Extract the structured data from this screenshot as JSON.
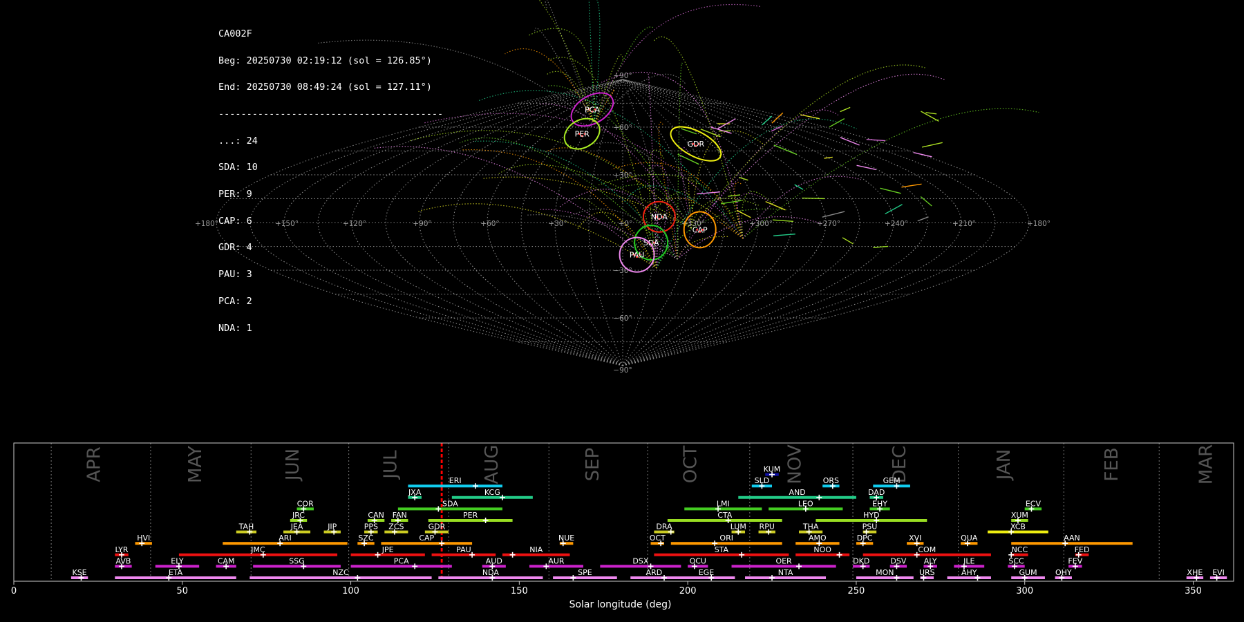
{
  "info": {
    "camera": "CA002F",
    "begin": "Beg: 20250730 02:19:12 (sol = 126.85°)",
    "end": "End: 20250730 08:49:24 (sol = 127.11°)",
    "separator": "----------------------------------------",
    "counts": [
      {
        "label": "...: 24"
      },
      {
        "label": "SDA: 10"
      },
      {
        "label": "PER: 9"
      },
      {
        "label": "CAP: 6"
      },
      {
        "label": "GDR: 4"
      },
      {
        "label": "PAU: 3"
      },
      {
        "label": "PCA: 2"
      },
      {
        "label": "NDA: 1"
      }
    ]
  },
  "colors": {
    "background": "#000000",
    "grid": "#9a9a9a",
    "axis": "#cccccc",
    "solar_marker": "#ff0000",
    "month_label": "#555555"
  },
  "chart_data": [
    {
      "type": "scatter",
      "projection": "sinusoidal",
      "grid": true,
      "lon_ticks": [
        "+180°",
        "+150°",
        "+120°",
        "+90°",
        "+60°",
        "+30°",
        "+0°",
        "+330°",
        "+300°",
        "+270°",
        "+240°",
        "+210°",
        "+180°"
      ],
      "lat_ticks": [
        "+90°",
        "+60°",
        "+30°",
        "+0°",
        "−30°",
        "−60°",
        "−90°"
      ],
      "radiants": [
        {
          "name": "PCA",
          "color": "#cc22cc",
          "pos": [
            -0.075,
            0.79
          ],
          "rx": 20,
          "ry": 33,
          "rot": 60
        },
        {
          "name": "PER",
          "color": "#aaee22",
          "pos": [
            -0.1,
            0.62
          ],
          "rx": 20,
          "ry": 27,
          "rot": 60
        },
        {
          "name": "GDR",
          "color": "#eeee11",
          "pos": [
            0.18,
            0.55
          ],
          "rx": 18,
          "ry": 40,
          "rot": -62
        },
        {
          "name": "NDA",
          "color": "#ee2211",
          "pos": [
            0.09,
            0.04
          ],
          "rx": 23,
          "ry": 22,
          "rot": 0
        },
        {
          "name": "CAP",
          "color": "#ff9900",
          "pos": [
            0.19,
            -0.05
          ],
          "rx": 23,
          "ry": 26,
          "rot": 0
        },
        {
          "name": "SDA",
          "color": "#22cc22",
          "pos": [
            0.07,
            -0.14
          ],
          "rx": 24,
          "ry": 25,
          "rot": 0
        },
        {
          "name": "PAU",
          "color": "#ee88ee",
          "pos": [
            0.035,
            -0.225
          ],
          "rx": 25,
          "ry": 25,
          "rot": 0
        }
      ]
    },
    {
      "type": "bar",
      "xlabel": "Solar longitude (deg)",
      "xlim": [
        0,
        362
      ],
      "x_ticks": [
        0,
        50,
        100,
        150,
        200,
        250,
        300,
        350
      ],
      "current_sol": [
        126.85,
        127.11
      ],
      "months": [
        {
          "label": "APR",
          "start": 11.1,
          "center": 24
        },
        {
          "label": "MAY",
          "start": 40.6,
          "center": 54
        },
        {
          "label": "JUN",
          "start": 70.4,
          "center": 83
        },
        {
          "label": "JUL",
          "start": 99.4,
          "center": 112
        },
        {
          "label": "AUG",
          "start": 129.1,
          "center": 142
        },
        {
          "label": "SEP",
          "start": 158.8,
          "center": 172
        },
        {
          "label": "OCT",
          "start": 188.1,
          "center": 201
        },
        {
          "label": "NOV",
          "start": 218.4,
          "center": 232
        },
        {
          "label": "DEC",
          "start": 249.0,
          "center": 263
        },
        {
          "label": "JAN",
          "start": 280.3,
          "center": 294
        },
        {
          "label": "FEB",
          "start": 311.6,
          "center": 326
        },
        {
          "label": "MAR",
          "start": 339.9,
          "center": 354
        }
      ],
      "showers": [
        {
          "code": "KUM",
          "start": 223,
          "end": 227,
          "peak": 225,
          "row": 10,
          "color": "#1111aa"
        },
        {
          "code": "ERI",
          "start": 117,
          "end": 145,
          "peak": 137,
          "row": 9,
          "color": "#11ccee"
        },
        {
          "code": "SLD",
          "start": 219,
          "end": 225,
          "peak": 222,
          "row": 9,
          "color": "#11ccee"
        },
        {
          "code": "ORS",
          "start": 240,
          "end": 245,
          "peak": 243,
          "row": 9,
          "color": "#11ccee"
        },
        {
          "code": "GEM",
          "start": 255,
          "end": 266,
          "peak": 262,
          "row": 9,
          "color": "#11ccee"
        },
        {
          "code": "JXA",
          "start": 117,
          "end": 121,
          "peak": 119,
          "row": 8,
          "color": "#22cc88"
        },
        {
          "code": "KCG",
          "start": 130,
          "end": 154,
          "peak": 145,
          "row": 8,
          "color": "#22cc88"
        },
        {
          "code": "AND",
          "start": 215,
          "end": 250,
          "peak": 239,
          "row": 8,
          "color": "#22cc88"
        },
        {
          "code": "DAD",
          "start": 254,
          "end": 258,
          "peak": 256,
          "row": 8,
          "color": "#22cc88"
        },
        {
          "code": "COR",
          "start": 84,
          "end": 89,
          "peak": 86,
          "row": 7,
          "color": "#44cc22"
        },
        {
          "code": "SDA",
          "start": 114,
          "end": 145,
          "peak": 126,
          "row": 7,
          "color": "#44cc22"
        },
        {
          "code": "LMI",
          "start": 199,
          "end": 222,
          "peak": 209,
          "row": 7,
          "color": "#44cc22"
        },
        {
          "code": "LEO",
          "start": 224,
          "end": 246,
          "peak": 235,
          "row": 7,
          "color": "#44cc22"
        },
        {
          "code": "EHY",
          "start": 254,
          "end": 260,
          "peak": 257,
          "row": 7,
          "color": "#44cc22"
        },
        {
          "code": "ECV",
          "start": 300,
          "end": 305,
          "peak": 302,
          "row": 7,
          "color": "#44cc22"
        },
        {
          "code": "JRC",
          "start": 82,
          "end": 87,
          "peak": 85,
          "row": 6,
          "color": "#99dd22"
        },
        {
          "code": "CAN",
          "start": 105,
          "end": 110,
          "peak": 107,
          "row": 6,
          "color": "#99dd22"
        },
        {
          "code": "FAN",
          "start": 112,
          "end": 117,
          "peak": 114,
          "row": 6,
          "color": "#99dd22"
        },
        {
          "code": "PER",
          "start": 123,
          "end": 148,
          "peak": 140,
          "row": 6,
          "color": "#99dd22"
        },
        {
          "code": "CTA",
          "start": 194,
          "end": 228,
          "peak": 212,
          "row": 6,
          "color": "#99dd22"
        },
        {
          "code": "HYD",
          "start": 238,
          "end": 271,
          "peak": 256,
          "row": 6,
          "color": "#99dd22"
        },
        {
          "code": "XUM",
          "start": 296,
          "end": 301,
          "peak": 298,
          "row": 6,
          "color": "#99dd22"
        },
        {
          "code": "TAH",
          "start": 66,
          "end": 72,
          "peak": 70,
          "row": 5,
          "color": "#cccc22"
        },
        {
          "code": "JEA",
          "start": 80,
          "end": 88,
          "peak": 84,
          "row": 5,
          "color": "#cccc22"
        },
        {
          "code": "JIP",
          "start": 92,
          "end": 97,
          "peak": 95,
          "row": 5,
          "color": "#cccc22"
        },
        {
          "code": "PPS",
          "start": 104,
          "end": 108,
          "peak": 106,
          "row": 5,
          "color": "#cccc22"
        },
        {
          "code": "ZCS",
          "start": 110,
          "end": 117,
          "peak": 113,
          "row": 5,
          "color": "#cccc22"
        },
        {
          "code": "GDR",
          "start": 122,
          "end": 129,
          "peak": 125,
          "row": 5,
          "color": "#cccc22"
        },
        {
          "code": "DRA",
          "start": 190,
          "end": 196,
          "peak": 195,
          "row": 5,
          "color": "#cccc22"
        },
        {
          "code": "LUM",
          "start": 213,
          "end": 217,
          "peak": 215,
          "row": 5,
          "color": "#cccc22"
        },
        {
          "code": "RPU",
          "start": 221,
          "end": 226,
          "peak": 224,
          "row": 5,
          "color": "#cccc22"
        },
        {
          "code": "THA",
          "start": 233,
          "end": 240,
          "peak": 236,
          "row": 5,
          "color": "#cccc22"
        },
        {
          "code": "PSU",
          "start": 252,
          "end": 256,
          "peak": 253,
          "row": 5,
          "color": "#cccc22"
        },
        {
          "code": "XCB",
          "start": 289,
          "end": 307,
          "peak": 296,
          "row": 5,
          "color": "#eeee11"
        },
        {
          "code": "HVI",
          "start": 36,
          "end": 41,
          "peak": 38,
          "row": 4,
          "color": "#ff9900"
        },
        {
          "code": "ARI",
          "start": 62,
          "end": 99,
          "peak": 79,
          "row": 4,
          "color": "#ff9900"
        },
        {
          "code": "SZC",
          "start": 102,
          "end": 107,
          "peak": 104,
          "row": 4,
          "color": "#ff9900"
        },
        {
          "code": "CAP",
          "start": 109,
          "end": 136,
          "peak": 127,
          "row": 4,
          "color": "#ff9900"
        },
        {
          "code": "NUE",
          "start": 162,
          "end": 166,
          "peak": 163,
          "row": 4,
          "color": "#ff9900"
        },
        {
          "code": "OCT",
          "start": 189,
          "end": 193,
          "peak": 192,
          "row": 4,
          "color": "#ff9900"
        },
        {
          "code": "ORI",
          "start": 195,
          "end": 228,
          "peak": 208,
          "row": 4,
          "color": "#ff9900"
        },
        {
          "code": "AMO",
          "start": 232,
          "end": 245,
          "peak": 239,
          "row": 4,
          "color": "#ff9900"
        },
        {
          "code": "DPC",
          "start": 250,
          "end": 255,
          "peak": 252,
          "row": 4,
          "color": "#ff9900"
        },
        {
          "code": "XVI",
          "start": 265,
          "end": 270,
          "peak": 268,
          "row": 4,
          "color": "#ff9900"
        },
        {
          "code": "QUA",
          "start": 281,
          "end": 286,
          "peak": 283,
          "row": 4,
          "color": "#ff9900"
        },
        {
          "code": "AAN",
          "start": 296,
          "end": 332,
          "peak": 312,
          "row": 4,
          "color": "#ff9900"
        },
        {
          "code": "LYR",
          "start": 30,
          "end": 34,
          "peak": 32,
          "row": 3,
          "color": "#ee1111"
        },
        {
          "code": "JMC",
          "start": 49,
          "end": 96,
          "peak": 74,
          "row": 3,
          "color": "#ee1111"
        },
        {
          "code": "JPE",
          "start": 100,
          "end": 122,
          "peak": 108,
          "row": 3,
          "color": "#ee1111"
        },
        {
          "code": "PAU",
          "start": 124,
          "end": 143,
          "peak": 136,
          "row": 3,
          "color": "#ee1111"
        },
        {
          "code": "NIA",
          "start": 145,
          "end": 165,
          "peak": 148,
          "row": 3,
          "color": "#ee1111"
        },
        {
          "code": "STA",
          "start": 190,
          "end": 230,
          "peak": 216,
          "row": 3,
          "color": "#ee1111"
        },
        {
          "code": "NOO",
          "start": 232,
          "end": 248,
          "peak": 245,
          "row": 3,
          "color": "#ee1111"
        },
        {
          "code": "COM",
          "start": 252,
          "end": 290,
          "peak": 268,
          "row": 3,
          "color": "#ee1111"
        },
        {
          "code": "NCC",
          "start": 296,
          "end": 301,
          "peak": 296,
          "row": 3,
          "color": "#ee1111"
        },
        {
          "code": "FED",
          "start": 315,
          "end": 319,
          "peak": 316,
          "row": 3,
          "color": "#ee1111"
        },
        {
          "code": "AVB",
          "start": 30,
          "end": 35,
          "peak": 32,
          "row": 2,
          "color": "#cc22cc"
        },
        {
          "code": "ELY",
          "start": 42,
          "end": 55,
          "peak": 49,
          "row": 2,
          "color": "#cc22cc"
        },
        {
          "code": "CAM",
          "start": 60,
          "end": 66,
          "peak": 63,
          "row": 2,
          "color": "#cc22cc"
        },
        {
          "code": "SSG",
          "start": 71,
          "end": 97,
          "peak": 86,
          "row": 2,
          "color": "#cc22cc"
        },
        {
          "code": "PCA",
          "start": 100,
          "end": 130,
          "peak": 119,
          "row": 2,
          "color": "#cc22cc"
        },
        {
          "code": "AUD",
          "start": 139,
          "end": 146,
          "peak": 142,
          "row": 2,
          "color": "#cc22cc"
        },
        {
          "code": "AUR",
          "start": 153,
          "end": 169,
          "peak": 158,
          "row": 2,
          "color": "#cc22cc"
        },
        {
          "code": "DSX",
          "start": 174,
          "end": 198,
          "peak": 189,
          "row": 2,
          "color": "#cc22cc"
        },
        {
          "code": "OCU",
          "start": 200,
          "end": 206,
          "peak": 202,
          "row": 2,
          "color": "#cc22cc"
        },
        {
          "code": "OER",
          "start": 213,
          "end": 244,
          "peak": 233,
          "row": 2,
          "color": "#cc22cc"
        },
        {
          "code": "DKD",
          "start": 249,
          "end": 254,
          "peak": 252,
          "row": 2,
          "color": "#cc22cc"
        },
        {
          "code": "DSV",
          "start": 260,
          "end": 265,
          "peak": 262,
          "row": 2,
          "color": "#cc22cc"
        },
        {
          "code": "ALY",
          "start": 270,
          "end": 274,
          "peak": 272,
          "row": 2,
          "color": "#cc22cc"
        },
        {
          "code": "ILE",
          "start": 279,
          "end": 288,
          "peak": 282,
          "row": 2,
          "color": "#cc22cc"
        },
        {
          "code": "SCC",
          "start": 295,
          "end": 300,
          "peak": 297,
          "row": 2,
          "color": "#cc22cc"
        },
        {
          "code": "FEV",
          "start": 313,
          "end": 317,
          "peak": 315,
          "row": 2,
          "color": "#cc22cc"
        },
        {
          "code": "KSE",
          "start": 17,
          "end": 22,
          "peak": 20,
          "row": 1,
          "color": "#ee88ee"
        },
        {
          "code": "ETA",
          "start": 30,
          "end": 66,
          "peak": 46,
          "row": 1,
          "color": "#ee88ee"
        },
        {
          "code": "NZC",
          "start": 70,
          "end": 124,
          "peak": 102,
          "row": 1,
          "color": "#ee88ee"
        },
        {
          "code": "NDA",
          "start": 126,
          "end": 157,
          "peak": 142,
          "row": 1,
          "color": "#ee88ee"
        },
        {
          "code": "SPE",
          "start": 160,
          "end": 179,
          "peak": 166,
          "row": 1,
          "color": "#ee88ee"
        },
        {
          "code": "ARD",
          "start": 183,
          "end": 197,
          "peak": 193,
          "row": 1,
          "color": "#ee88ee"
        },
        {
          "code": "EGE",
          "start": 197,
          "end": 214,
          "peak": 207,
          "row": 1,
          "color": "#ee88ee"
        },
        {
          "code": "NTA",
          "start": 217,
          "end": 241,
          "peak": 225,
          "row": 1,
          "color": "#ee88ee"
        },
        {
          "code": "MON",
          "start": 250,
          "end": 267,
          "peak": 262,
          "row": 1,
          "color": "#ee88ee"
        },
        {
          "code": "URS",
          "start": 269,
          "end": 273,
          "peak": 270,
          "row": 1,
          "color": "#ee88ee"
        },
        {
          "code": "AHY",
          "start": 277,
          "end": 290,
          "peak": 286,
          "row": 1,
          "color": "#ee88ee"
        },
        {
          "code": "GUM",
          "start": 296,
          "end": 306,
          "peak": 300,
          "row": 1,
          "color": "#ee88ee"
        },
        {
          "code": "OHY",
          "start": 309,
          "end": 314,
          "peak": 311,
          "row": 1,
          "color": "#ee88ee"
        },
        {
          "code": "XHE",
          "start": 348,
          "end": 353,
          "peak": 351,
          "row": 1,
          "color": "#ee88ee"
        },
        {
          "code": "EVI",
          "start": 355,
          "end": 360,
          "peak": 357,
          "row": 1,
          "color": "#ee88ee"
        }
      ]
    }
  ]
}
